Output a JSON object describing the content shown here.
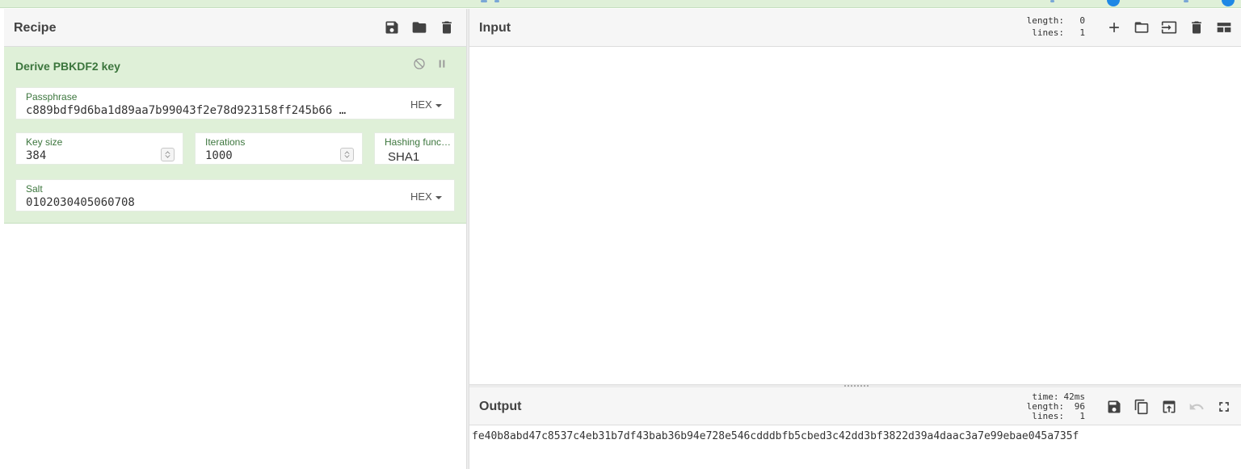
{
  "recipe": {
    "title": "Recipe",
    "operation": {
      "name": "Derive PBKDF2 key",
      "passphrase": {
        "label": "Passphrase",
        "value": "c889bdf9d6ba1d89aa7b99043f2e78d923158ff245b66 …",
        "format": "HEX"
      },
      "key_size": {
        "label": "Key size",
        "value": "384"
      },
      "iterations": {
        "label": "Iterations",
        "value": "1000"
      },
      "hashing_function": {
        "label": "Hashing funct…",
        "value": "SHA1"
      },
      "salt": {
        "label": "Salt",
        "value": "0102030405060708",
        "format": "HEX"
      }
    }
  },
  "input": {
    "title": "Input",
    "stats": {
      "length_label": "length:",
      "length": "0",
      "lines_label": "lines:",
      "lines": "1"
    }
  },
  "output": {
    "title": "Output",
    "stats": {
      "time_label": "time:",
      "time": "42ms",
      "length_label": "length:",
      "length": "96",
      "lines_label": "lines:",
      "lines": "1"
    },
    "value": "fe40b8abd47c8537c4eb31b7df43bab36b94e728e546cdddbfb5cbed3c42dd3bf3822d39a4daac3a7e99ebae045a735f"
  },
  "colors": {
    "op_bg": "#dff0d8",
    "op_text": "#3c763d",
    "topbar": "#dff0d8",
    "accent_blue": "#1e88e5"
  }
}
